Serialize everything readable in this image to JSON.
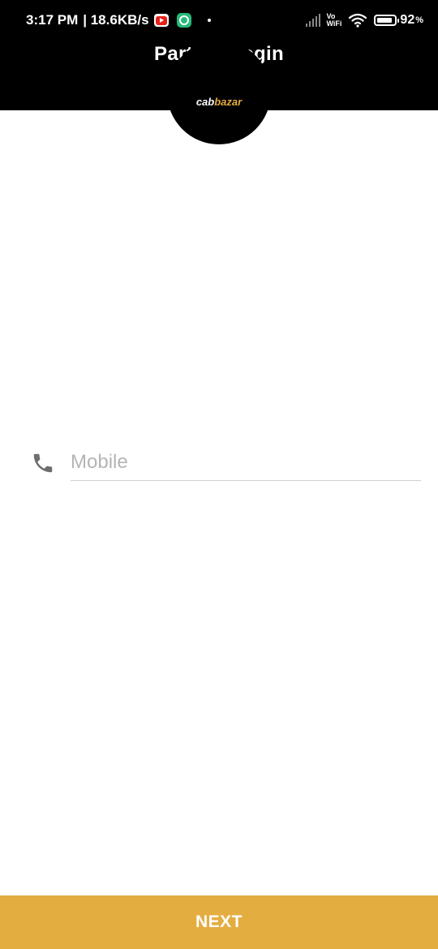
{
  "status_bar": {
    "time": "3:17 PM",
    "network_speed": "| 18.6KB/s",
    "notification_icons": [
      "youtube-icon",
      "clock-app-icon"
    ],
    "vo_label": "Vo",
    "wifi_label": "WiFi",
    "battery_level": 92,
    "battery_percent": "92",
    "battery_unit": "%"
  },
  "header": {
    "title": "Partner Login",
    "logo": {
      "part1": "cab",
      "part2": "bazar"
    }
  },
  "form": {
    "mobile": {
      "value": "",
      "placeholder": "Mobile",
      "icon": "phone-icon"
    }
  },
  "footer": {
    "next_label": "NEXT"
  },
  "colors": {
    "header_bg": "#000000",
    "accent": "#e3ad40",
    "placeholder": "#b5b5b5",
    "icon": "#6e6e6e"
  }
}
